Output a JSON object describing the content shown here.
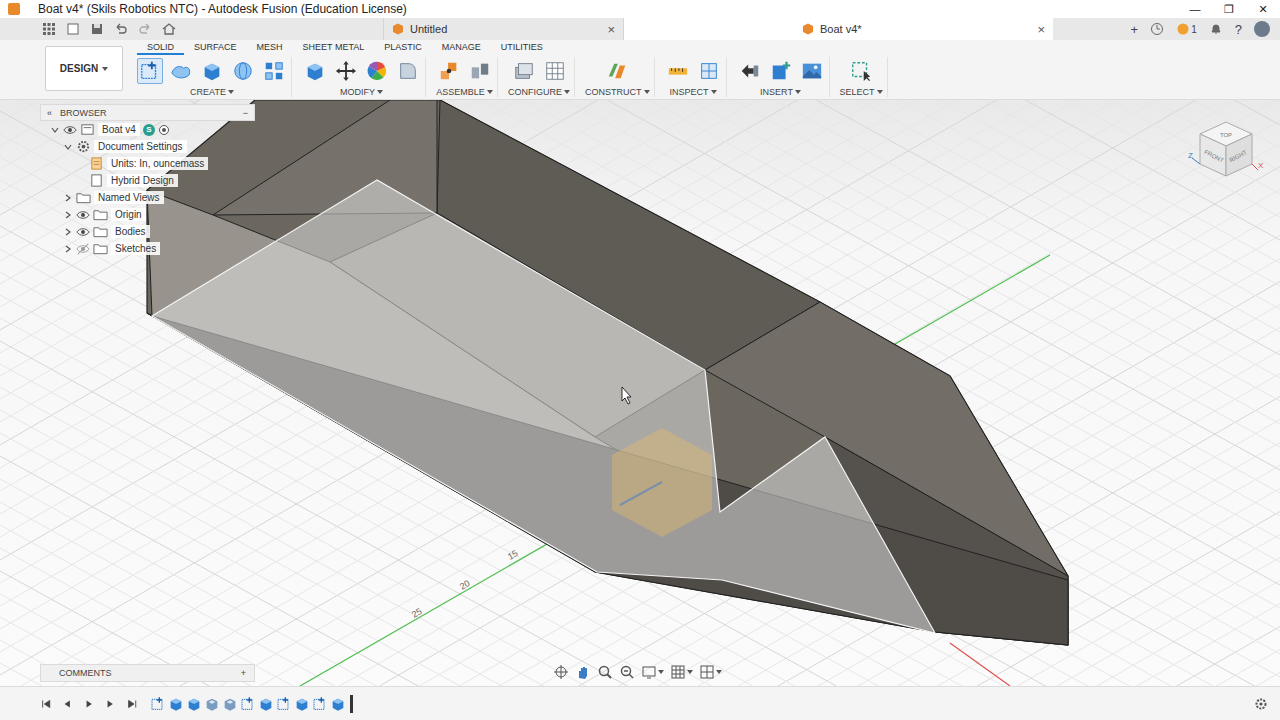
{
  "window": {
    "title": "Boat v4* (Skils Robotics NTC) - Autodesk Fusion (Education License)",
    "controls": [
      "—",
      "❐",
      "✕"
    ]
  },
  "doc_tabs": [
    {
      "label": "Untitled",
      "selected": false,
      "close": "×"
    },
    {
      "label": "Boat v4*",
      "selected": true,
      "close": "×"
    }
  ],
  "header": {
    "new_tab": "+",
    "jobs_count": "1",
    "help": "?"
  },
  "workspace": {
    "label": "DESIGN"
  },
  "toolbar_tabs": [
    {
      "label": "SOLID",
      "selected": true
    },
    {
      "label": "SURFACE",
      "selected": false
    },
    {
      "label": "MESH",
      "selected": false
    },
    {
      "label": "SHEET METAL",
      "selected": false
    },
    {
      "label": "PLASTIC",
      "selected": false
    },
    {
      "label": "MANAGE",
      "selected": false
    },
    {
      "label": "UTILITIES",
      "selected": false
    }
  ],
  "tool_groups": [
    {
      "label": "CREATE",
      "tools": [
        {
          "kind": "sketch",
          "selected": true
        },
        {
          "kind": "form",
          "selected": false
        },
        {
          "kind": "extrude",
          "selected": false
        },
        {
          "kind": "revolve",
          "selected": false
        },
        {
          "kind": "pattern",
          "selected": false
        }
      ]
    },
    {
      "label": "MODIFY",
      "tools": [
        {
          "kind": "press",
          "selected": false
        },
        {
          "kind": "move",
          "selected": false
        },
        {
          "kind": "appearance",
          "selected": false
        },
        {
          "kind": "fillet",
          "selected": false
        }
      ]
    },
    {
      "label": "ASSEMBLE",
      "tools": [
        {
          "kind": "joint",
          "selected": false
        },
        {
          "kind": "rigid",
          "selected": false
        }
      ]
    },
    {
      "label": "CONFIGURE",
      "tools": [
        {
          "kind": "configure",
          "selected": false
        },
        {
          "kind": "table",
          "selected": false
        }
      ]
    },
    {
      "label": "CONSTRUCT",
      "tools": [
        {
          "kind": "plane",
          "selected": false
        }
      ]
    },
    {
      "label": "INSPECT",
      "tools": [
        {
          "kind": "measure",
          "selected": false
        },
        {
          "kind": "section",
          "selected": false
        }
      ]
    },
    {
      "label": "INSERT",
      "tools": [
        {
          "kind": "derive",
          "selected": false
        },
        {
          "kind": "insert",
          "selected": false
        },
        {
          "kind": "canvas",
          "selected": false
        }
      ]
    },
    {
      "label": "SELECT",
      "tools": [
        {
          "kind": "select",
          "selected": false
        }
      ]
    }
  ],
  "browser": {
    "title": "BROWSER",
    "collapse": "«",
    "minimize": "−",
    "items": [
      {
        "label": "Boat v4",
        "kind": "document",
        "expanded": true,
        "eye": "shown",
        "badge": "S",
        "children": [
          {
            "label": "Document Settings",
            "kind": "settings",
            "expanded": true,
            "eye": "none",
            "children": [
              {
                "label": "Units: In, ouncemass",
                "kind": "units",
                "eye": "none",
                "children": []
              },
              {
                "label": "Hybrid Design",
                "kind": "design",
                "eye": "none",
                "children": []
              }
            ]
          },
          {
            "label": "Named Views",
            "kind": "folder",
            "expanded": false,
            "eye": "none",
            "children": []
          },
          {
            "label": "Origin",
            "kind": "folder",
            "expanded": false,
            "eye": "shown",
            "children": []
          },
          {
            "label": "Bodies",
            "kind": "folder",
            "expanded": false,
            "eye": "shown",
            "children": []
          },
          {
            "label": "Sketches",
            "kind": "folder",
            "expanded": false,
            "eye": "hidden",
            "children": []
          }
        ]
      }
    ]
  },
  "canvas": {
    "grid_labels": [
      "15",
      "20",
      "25"
    ]
  },
  "viewcube": {
    "faces": [
      "TOP",
      "FRONT",
      "RIGHT"
    ],
    "axes": [
      "Z",
      "X"
    ]
  },
  "comments": {
    "label": "COMMENTS",
    "add": "+"
  },
  "nav_tools": [
    {
      "kind": "orbit"
    },
    {
      "kind": "pan"
    },
    {
      "kind": "zoom"
    },
    {
      "kind": "fit"
    },
    {
      "kind": "display"
    },
    {
      "kind": "grid"
    },
    {
      "kind": "viewports"
    }
  ],
  "timeline": {
    "features": [
      {
        "kind": "sketch"
      },
      {
        "kind": "extrude"
      },
      {
        "kind": "extrude"
      },
      {
        "kind": "shell"
      },
      {
        "kind": "shell"
      },
      {
        "kind": "sketch"
      },
      {
        "kind": "extrude"
      },
      {
        "kind": "sketch"
      },
      {
        "kind": "extrude"
      },
      {
        "kind": "sketch"
      },
      {
        "kind": "extrude"
      }
    ]
  }
}
